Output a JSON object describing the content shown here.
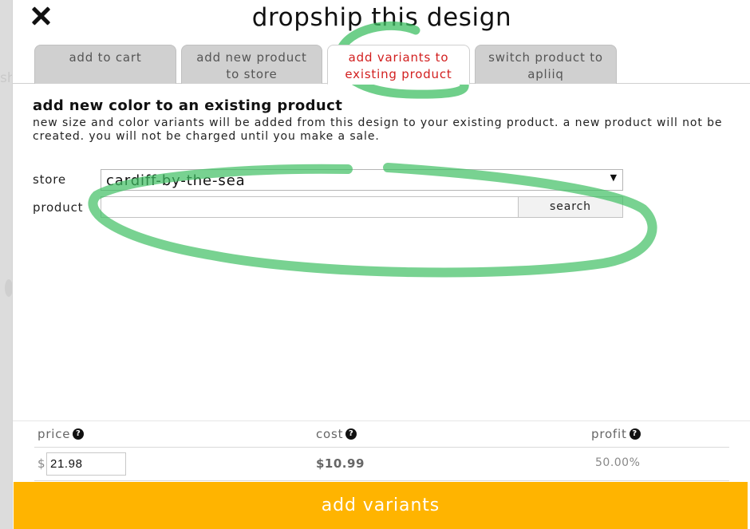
{
  "backdrop": {
    "fragment": "sh"
  },
  "modal": {
    "title": "dropship this design",
    "tabs": [
      {
        "line1": "add to cart",
        "line2": ""
      },
      {
        "line1": "add new product",
        "line2": "to store"
      },
      {
        "line1": "add variants to",
        "line2": "existing product"
      },
      {
        "line1": "switch product to",
        "line2": "apliiq"
      }
    ],
    "active_tab": "add variants to existing product"
  },
  "section": {
    "heading": "add new color to an existing product",
    "description": "new size and color variants will be added from this design to your existing product. a new product will not be created. you will not be charged until you make a sale."
  },
  "form": {
    "store_label": "store",
    "store_value": "cardiff-by-the-sea",
    "product_label": "product",
    "product_value": "",
    "search_label": "search"
  },
  "pricing": {
    "price_label": "price",
    "cost_label": "cost",
    "profit_label": "profit",
    "help_glyph": "?",
    "currency_symbol": "$",
    "price_value": "21.98",
    "cost_value": "$10.99",
    "profit_value": "50.00%"
  },
  "actions": {
    "add_variants_label": "add variants"
  },
  "colors": {
    "accent": "#ffb400",
    "active_tab_text": "#d21f1f",
    "annotation_marker": "#3fbf63"
  }
}
